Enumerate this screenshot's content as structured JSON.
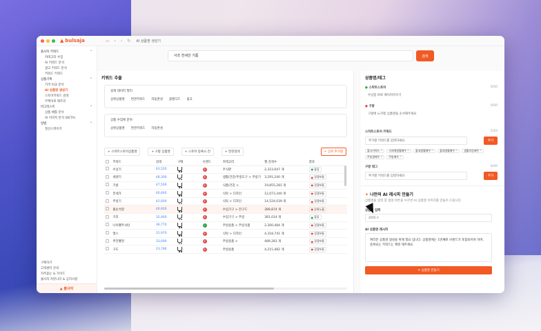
{
  "app": {
    "brand": "bulsaja",
    "tab_title": "AI 상품명 생성기"
  },
  "sidebar": {
    "groups": [
      {
        "label": "플사자 키워드",
        "items": [
          "카테고리 수집",
          "AI 키워드 분석",
          "광고 키워드 분석",
          "키워드 키워드"
        ]
      },
      {
        "label": "상품기획",
        "items": [
          "가격 비교 분석",
          "AI 상품명 생성기",
          "스토어키워드 검색",
          "부케어로 매트리"
        ]
      },
      {
        "label": "마그리스트",
        "items": [
          "상품 배틀 분석",
          "AI 이미지 분석 (BETA)"
        ]
      },
      {
        "label": "방법",
        "items": [
          "정산스파이즈"
        ]
      }
    ],
    "active": "AI 상품명 생성기",
    "bottom_items": [
      "구매하기",
      "고객센터 문의",
      "자주묻는 & 가이드",
      "불사자 커뮤니티 & 공지사항"
    ],
    "brand_label": "불사자"
  },
  "search": {
    "value": "사조 전세안 기름",
    "button": "검색"
  },
  "keyword_panel": {
    "title": "키워드 추출",
    "card1": {
      "label": "검색 데이터 필터",
      "chips": [
        "상위상품명",
        "연관키워드",
        "자동완성",
        "블렌디드",
        "광고"
      ]
    },
    "card2": {
      "label": "상품 수집에 분야",
      "chips": [
        "상위상품명",
        "연관키워드",
        "자동완성"
      ]
    },
    "buttons": [
      "+ 스마트스토어상품명",
      "+ 구팡 상품명",
      "+ 스토어 등록시 전",
      "+ 연관검색"
    ],
    "orange_button": "+ 상위 추가별",
    "columns": [
      "키워드",
      "검색",
      "구매",
      "브랜드",
      "카테고리",
      "월 검색수",
      "결과"
    ],
    "rows": [
      [
        "수상기",
        "63,520",
        "2,323,647 개",
        "좋음"
      ],
      [
        "세렌기",
        "48,300",
        "3,291,240 개",
        "경쟁보통"
      ],
      [
        "기름",
        "47,500",
        "19,855,281 개",
        "경쟁보통"
      ],
      [
        "전세가",
        "40,640",
        "12,073,340 개",
        "경쟁보통"
      ],
      [
        "주방기",
        "42,600",
        "14,524,039 개",
        "경쟁보통"
      ],
      [
        "출순석량",
        "40,920",
        "389,874 개",
        "상위노출"
      ],
      [
        "기포",
        "32,460",
        "381,014 개",
        "좋음"
      ],
      [
        "나이팰주사탄",
        "36,770",
        "2,300,484 개",
        "경쟁보통"
      ],
      [
        "맹스",
        "31,970",
        "4,318,741 개",
        "경쟁보통"
      ],
      [
        "추전팰천",
        "33,690",
        "489,281 개",
        "경쟁보통"
      ],
      [
        "구도",
        "23,780",
        "4,215,482 개",
        "경쟁보통"
      ]
    ],
    "categories": [
      "주식판",
      "생활/건강/주방도구 > 주방기",
      "식품/건강 >",
      "식탁 > 디자인",
      "식탁 > 디자인",
      "수입기구 > 한구드",
      "수입기구 > 주방",
      "주방용품 > 주방식품",
      "식탁 > 디자인",
      "주방용품 >",
      "주방용품"
    ]
  },
  "right_panel": {
    "title": "상품명/태그",
    "store_label": "스마트스토어",
    "store_count": "0/50",
    "store_value": "수납함 바로 매이커지우기",
    "coupang_label": "구팡",
    "coupang_count": "0/50",
    "coupang_placeholder": "구팡에 노치할 상품명을 순서해주세요",
    "tags_label": "스마트스토어 키워드",
    "tags_count": "5/10",
    "tags_placeholder": "추가할 키워드를 입력하세요",
    "add_label": "추가",
    "tag_chips": [
      "출사키워드",
      "기세계생활배우",
      "출세생활배우",
      "출세생활배우",
      "생활모듬배우",
      "주방생배우",
      "주방배우"
    ],
    "coupang_tags_label": "구팡 태그",
    "coupang_tags_count": "0/20",
    "coupang_tags_placeholder": "추가할 키워드를 입력하세요",
    "ai_title": "나만의 AI 레시피 만들기",
    "ai_desc": "상품명을 입력 후 생성 버튼을 누르면 AI 상품명 이미지를 만들어 드립니다.",
    "ai_field_label": "상품명 입력",
    "ai_field_value": "20대 스",
    "ai_prompt_label": "AI 상품명 레시피",
    "ai_prompt_text": "여러분 상품명 생성을 위해 필요 입니다. 상품명에는 1번째로 브랜드가 포함되어야 하며, 중복되는 키워드는 제외 해주세요.",
    "generate_button": "상품명 만들기"
  },
  "colors": {
    "accent": "#f15a24",
    "link": "#3b82f6",
    "bad": "#e04848",
    "good": "#29a44a"
  }
}
